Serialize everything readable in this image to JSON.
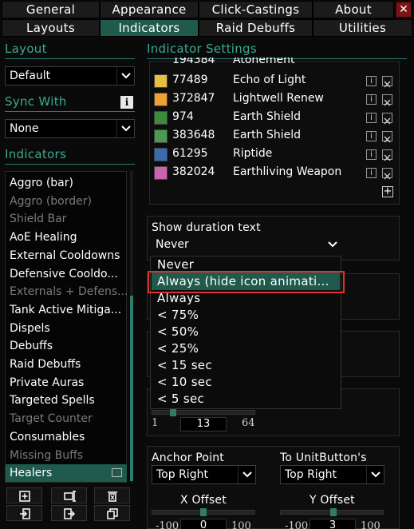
{
  "tabs_row1": [
    {
      "label": "General"
    },
    {
      "label": "Appearance"
    },
    {
      "label": "Click-Castings"
    },
    {
      "label": "About"
    }
  ],
  "tabs_row2": [
    {
      "label": "Layouts"
    },
    {
      "label": "Indicators"
    },
    {
      "label": "Raid Debuffs"
    },
    {
      "label": "Utilities"
    }
  ],
  "close_label": "✕",
  "layout": {
    "title": "Layout",
    "value": "Default"
  },
  "sync": {
    "title": "Sync With",
    "value": "None",
    "info": "i"
  },
  "indicators": {
    "title": "Indicators",
    "items": [
      {
        "label": "Aggro (bar)",
        "state": "enabled"
      },
      {
        "label": "Aggro (border)",
        "state": "disabled"
      },
      {
        "label": "Shield Bar",
        "state": "disabled"
      },
      {
        "label": "AoE Healing",
        "state": "enabled"
      },
      {
        "label": "External Cooldowns",
        "state": "enabled"
      },
      {
        "label": "Defensive Cooldo...",
        "state": "enabled"
      },
      {
        "label": "Externals + Defens...",
        "state": "disabled"
      },
      {
        "label": "Tank Active Mitiga...",
        "state": "enabled"
      },
      {
        "label": "Dispels",
        "state": "enabled"
      },
      {
        "label": "Debuffs",
        "state": "enabled"
      },
      {
        "label": "Raid Debuffs",
        "state": "enabled"
      },
      {
        "label": "Private Auras",
        "state": "enabled"
      },
      {
        "label": "Targeted Spells",
        "state": "enabled"
      },
      {
        "label": "Target Counter",
        "state": "disabled"
      },
      {
        "label": "Consumables",
        "state": "enabled"
      },
      {
        "label": "Missing Buffs",
        "state": "disabled"
      },
      {
        "label": "Healers",
        "state": "selected"
      }
    ]
  },
  "settings": {
    "title": "Indicator Settings",
    "partial_row": {
      "id": "194384",
      "name": "Atonement"
    },
    "spells": [
      {
        "id": "77489",
        "name": "Echo of Light",
        "color": "#e8c040"
      },
      {
        "id": "372847",
        "name": "Lightwell Renew",
        "color": "#f0a030"
      },
      {
        "id": "974",
        "name": "Earth Shield",
        "color": "#3c8a3c"
      },
      {
        "id": "383648",
        "name": "Earth Shield",
        "color": "#4a9a50"
      },
      {
        "id": "61295",
        "name": "Riptide",
        "color": "#3a6ab0"
      },
      {
        "id": "382024",
        "name": "Earthliving Weapon",
        "color": "#d060b0"
      }
    ],
    "add_label": "+",
    "duration": {
      "label": "Show duration text",
      "value": "Never"
    },
    "menu_options": [
      "Never",
      "Always (hide icon animati...",
      "Always",
      "< 75%",
      "< 50%",
      "< 25%",
      "< 15 sec",
      "< 10 sec",
      "< 5 sec"
    ],
    "size": {
      "min": "1",
      "value": "13",
      "max": "64",
      "fraction": 0.19
    },
    "anchor": {
      "label": "Anchor Point",
      "value": "Top Right"
    },
    "to_unit": {
      "label": "To UnitButton's",
      "value": "Top Right"
    },
    "x_offset": {
      "label": "X Offset",
      "min": "-100",
      "value": "0",
      "max": "100"
    },
    "y_offset": {
      "label": "Y Offset",
      "min": "-100",
      "value": "3",
      "max": "100"
    }
  },
  "colors": {
    "accent": "#2e7d6c",
    "accent_text": "#3aaa90",
    "highlight": "#1f5a4d",
    "annotation": "#e03030"
  }
}
